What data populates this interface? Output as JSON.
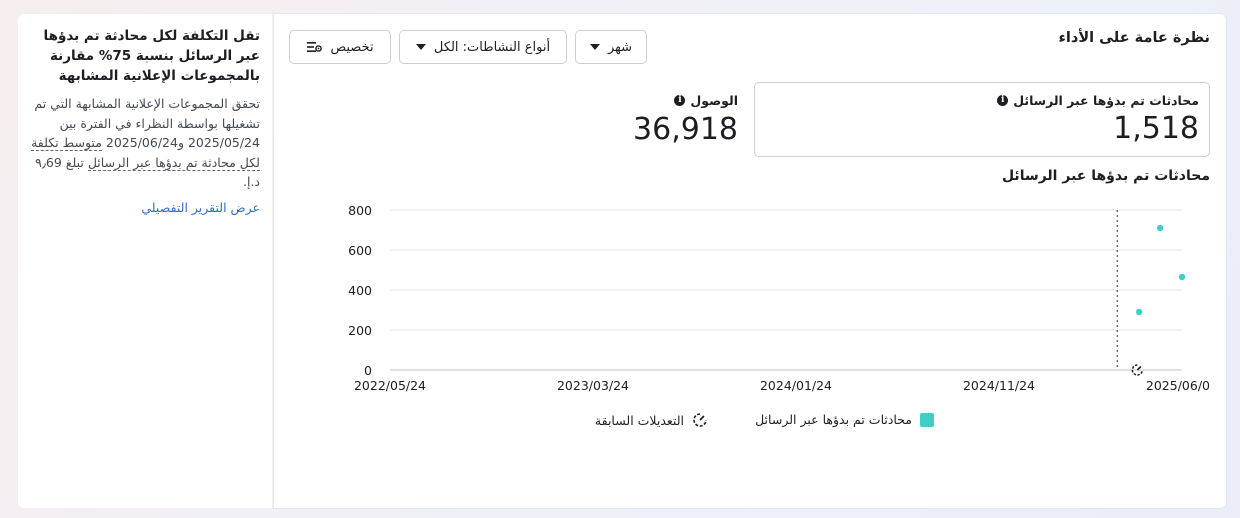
{
  "insight": {
    "title": "تقل التكلفة لكل محادثة تم بدؤها عبر الرسائل بنسبة 75% مقارنة بالمجموعات الإعلانية المشابهة",
    "body_prefix": "تحقق المجموعات الإعلانية المشابهة التي تم تشغيلها بواسطة النظراء في الفترة بين 2025/05/24 و2025/06/24 ",
    "body_dotted": "متوسط تكلفة لكل محادثة تم بدؤها عبر الرسائل",
    "body_suffix": " تبلغ ٩٫69 د.إ.",
    "link": "عرض التقرير التفصيلي"
  },
  "header": {
    "title": "نظرة عامة على الأداء",
    "period_label": "شهر",
    "activity_label": "أنواع النشاطات: الكل",
    "customize_label": "تخصيص"
  },
  "metrics": {
    "conversations": {
      "label": "محادثات تم بدؤها عبر الرسائل",
      "value": "1,518"
    },
    "reach": {
      "label": "الوصول",
      "value": "36,918"
    }
  },
  "chart_title": "محادثات تم بدؤها عبر الرسائل",
  "legend": {
    "series": "محادثات تم بدؤها عبر الرسائل",
    "edits": "التعديلات السابقة"
  },
  "colors": {
    "series": "#3ecfc6",
    "link": "#2f6fbf"
  },
  "chart_data": {
    "type": "scatter",
    "y_ticks": [
      0,
      200,
      400,
      600,
      800
    ],
    "ylim": [
      0,
      800
    ],
    "x_ticks": [
      "2022/05/24",
      "2023/03/24",
      "2024/01/24",
      "2024/11/24",
      "2025/06/0"
    ],
    "series": [
      {
        "name": "محادثات تم بدؤها عبر الرسائل",
        "points": [
          {
            "x": "2025/04/24",
            "y": 290
          },
          {
            "x": "2025/05/24",
            "y": 710
          },
          {
            "x": "2025/06/24",
            "y": 465
          }
        ]
      }
    ],
    "edit_marker": {
      "x": "2025/03/24"
    }
  }
}
